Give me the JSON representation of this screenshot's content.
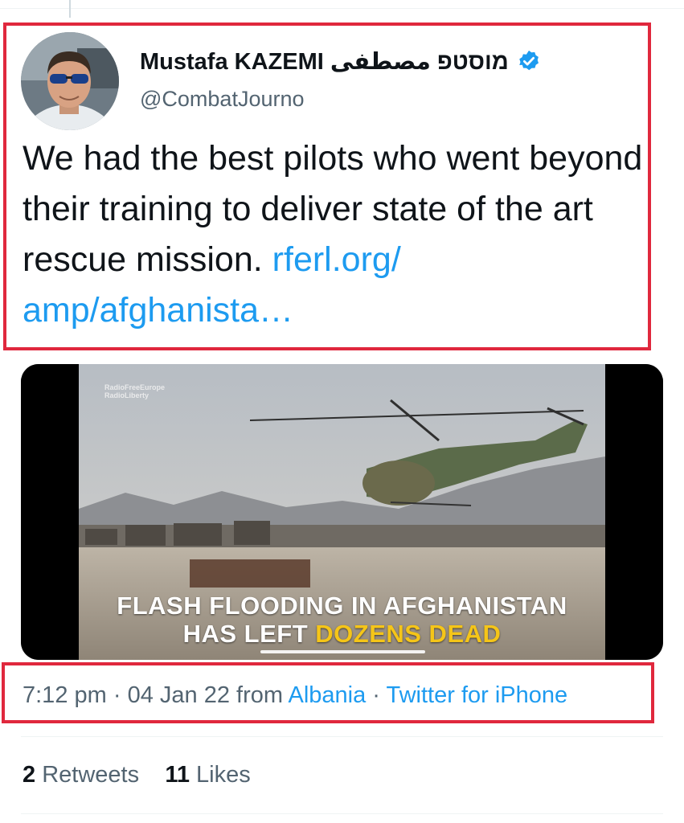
{
  "author": {
    "display_name": "Mustafa KAZEMI מוסטפ مصطفى",
    "handle": "@CombatJourno",
    "verified": true,
    "verified_icon": "verified-badge-icon",
    "avatar_icon": "avatar-photo"
  },
  "tweet": {
    "text": "We had the best pilots who went beyond their training to deliver state of the art rescue mission. ",
    "link_text": "rferl.org/ amp/afghanista…"
  },
  "media": {
    "watermark_line1": "RadioFreeEurope",
    "watermark_line2": "RadioLiberty",
    "caption_line1": "FLASH FLOODING IN AFGHANISTAN",
    "caption_line2_prefix": "HAS LEFT ",
    "caption_line2_highlight": "DOZENS DEAD"
  },
  "meta": {
    "time": "7:12 pm",
    "sep1": " · ",
    "date": "04 Jan 22",
    "from": " from ",
    "location": "Albania",
    "sep2": " · ",
    "client": "Twitter for iPhone"
  },
  "stats": {
    "retweets_count": "2",
    "retweets_label": " Retweets",
    "likes_count": "11",
    "likes_label": " Likes"
  },
  "colors": {
    "link": "#1d9bf0",
    "highlight_box": "#e0283d",
    "caption_highlight": "#f5c518",
    "secondary_text": "#536471"
  }
}
